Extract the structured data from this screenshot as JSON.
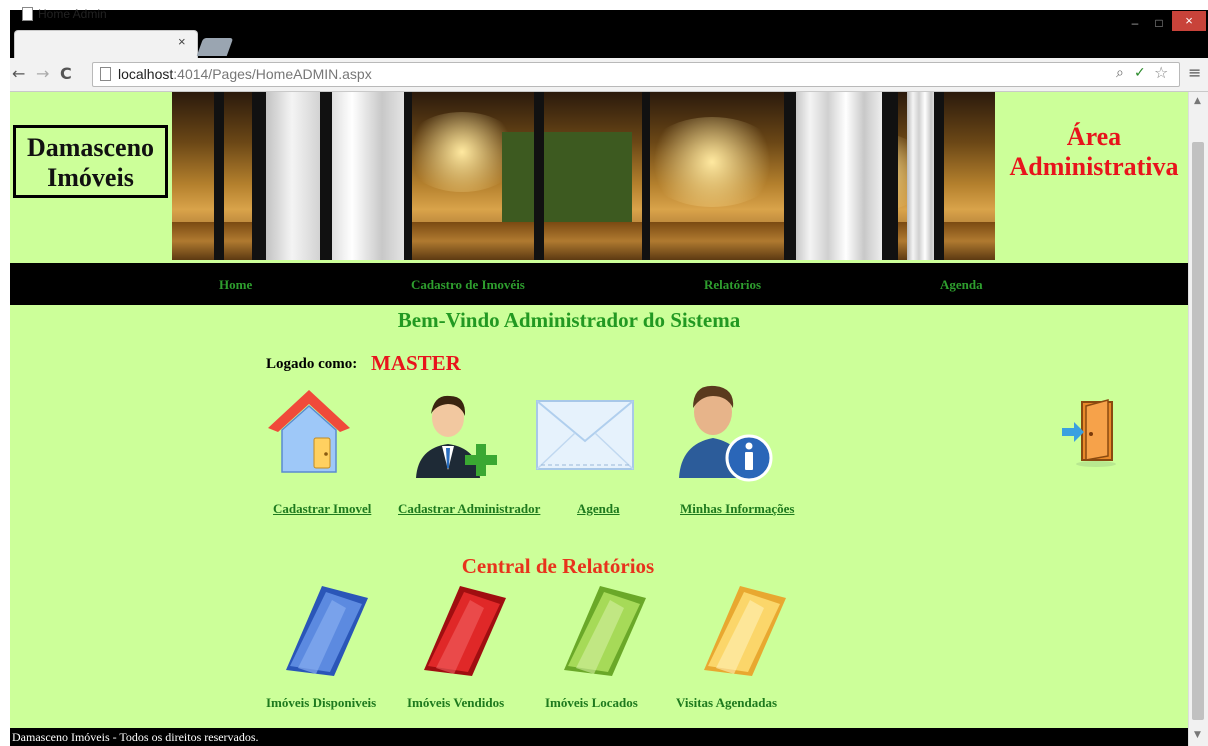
{
  "browser": {
    "tab_title": "Home Admin",
    "tab_close": "×",
    "url_host": "localhost",
    "url_rest": ":4014/Pages/HomeADMIN.aspx",
    "window_buttons": {
      "minimize": "–",
      "maximize": "□",
      "close": "×"
    },
    "icons": {
      "back": "←",
      "forward": "→",
      "reload": "C",
      "zoom": "⌕",
      "check": "✓",
      "star": "☆",
      "menu": "≡"
    }
  },
  "header": {
    "logo_line1": "Damasceno",
    "logo_line2": "Imóveis",
    "area_line1": "Área",
    "area_line2": "Administrativa"
  },
  "nav": {
    "items": [
      {
        "label": "Home"
      },
      {
        "label": "Cadastro de Imovéis"
      },
      {
        "label": "Relatórios"
      },
      {
        "label": "Agenda"
      }
    ]
  },
  "main": {
    "welcome": "Bem-Vindo Administrador do Sistema",
    "logged_label": "Logado como:",
    "logged_user": "MASTER",
    "actions": [
      {
        "label": "Cadastrar Imovel",
        "icon": "house-icon"
      },
      {
        "label": "Cadastrar Administrador",
        "icon": "add-user-icon"
      },
      {
        "label": "Agenda",
        "icon": "envelope-icon"
      },
      {
        "label": "Minhas Informações",
        "icon": "user-info-icon"
      }
    ],
    "logout_icon": "exit-door-icon"
  },
  "reports": {
    "title": "Central de Relatórios",
    "items": [
      {
        "label": "Imóveis Disponiveis",
        "color": "#3a6fd8"
      },
      {
        "label": "Imóveis Vendidos",
        "color": "#d42020"
      },
      {
        "label": "Imóveis Locados",
        "color": "#8ccc3a"
      },
      {
        "label": "Visitas Agendadas",
        "color": "#f7c84a"
      }
    ]
  },
  "footer": {
    "text": "Damasceno Imóveis - Todos os direitos reservados."
  },
  "colors": {
    "page_bg": "#ccff99",
    "accent_red": "#e8141c",
    "nav_green": "#2e9e2e"
  }
}
